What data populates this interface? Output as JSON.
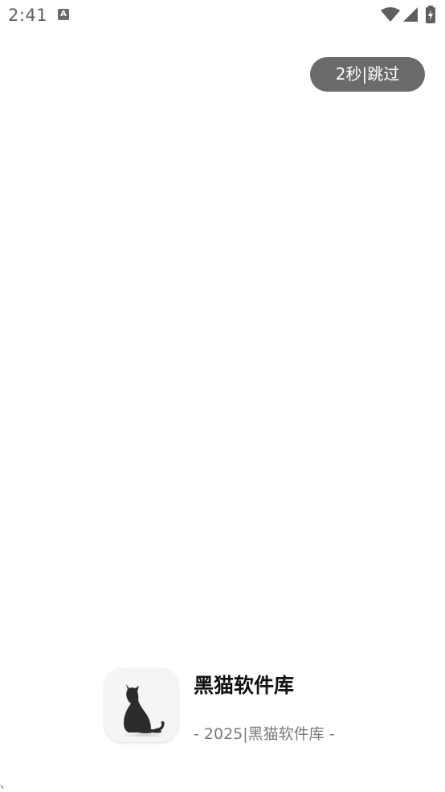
{
  "status_bar": {
    "time": "2:41",
    "notification_icon": "a-letter-icon",
    "icons": [
      "wifi-icon",
      "cell-signal-icon",
      "battery-charging-icon"
    ]
  },
  "skip_button": {
    "label": "2秒|跳过"
  },
  "brand": {
    "logo": "black-cat-icon",
    "name": "黑猫软件库",
    "slogan": "- 2025|黑猫软件库 -"
  },
  "colors": {
    "background": "#ffffff",
    "skip_button_bg": "#6b6b6b",
    "status_icons": "#5f5f5f"
  }
}
